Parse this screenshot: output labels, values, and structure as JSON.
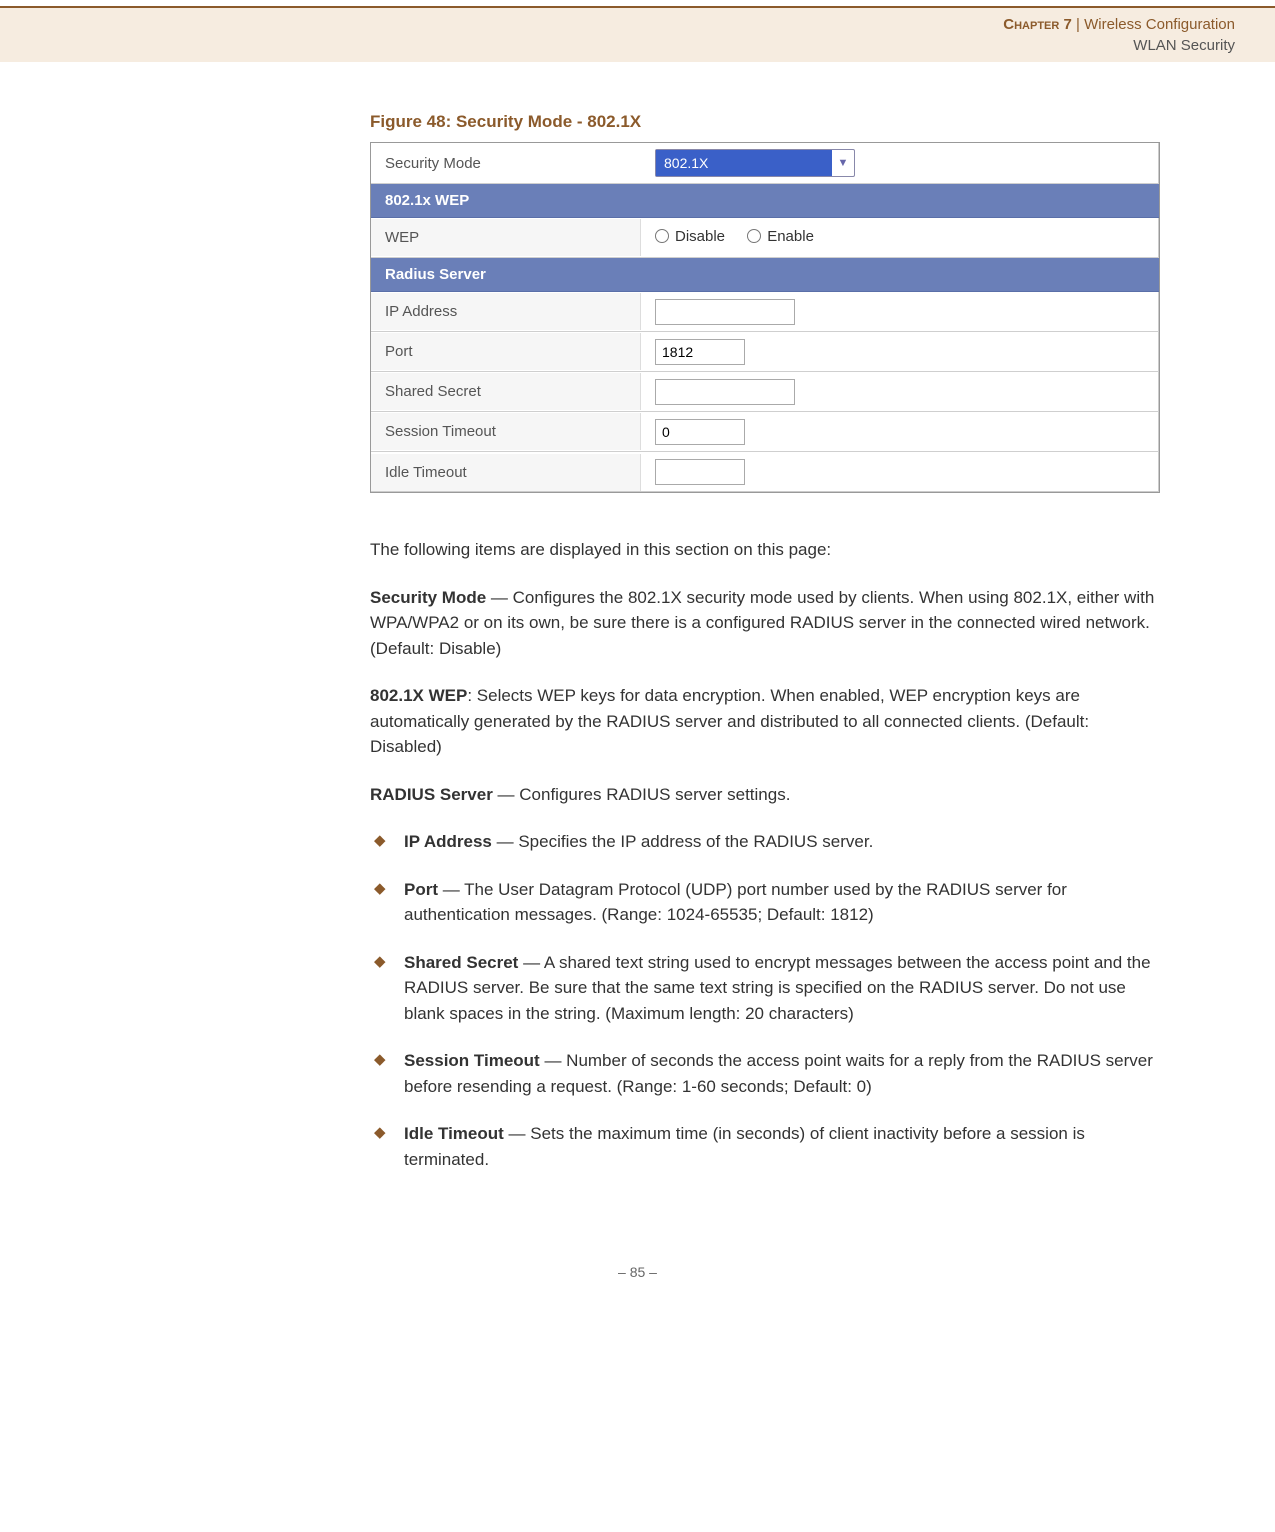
{
  "header": {
    "chapter": "Chapter 7",
    "sep": "|",
    "crumb": "Wireless Configuration",
    "sub": "WLAN Security"
  },
  "figure": {
    "caption": "Figure 48:  Security Mode - 802.1X",
    "securityMode": {
      "label": "Security Mode",
      "value": "802.1X"
    },
    "section1": "802.1x WEP",
    "wep": {
      "label": "WEP",
      "opt1": "Disable",
      "opt2": "Enable"
    },
    "section2": "Radius Server",
    "ip": {
      "label": "IP Address",
      "value": ""
    },
    "port": {
      "label": "Port",
      "value": "1812"
    },
    "secret": {
      "label": "Shared Secret",
      "value": ""
    },
    "session": {
      "label": "Session Timeout",
      "value": "0"
    },
    "idle": {
      "label": "Idle Timeout",
      "value": ""
    }
  },
  "body": {
    "intro": "The following items are displayed in this section on this page:",
    "p1b": "Security Mode",
    "p1": " — Configures the 802.1X security mode used by clients. When using 802.1X, either with WPA/WPA2 or on its own, be sure there is a configured RADIUS server in the connected wired network. (Default: Disable)",
    "p2b": "802.1X WEP",
    "p2": ": Selects WEP keys for data encryption. When enabled, WEP encryption keys are automatically generated by the RADIUS server and distributed to all connected clients. (Default: Disabled)",
    "p3b": "RADIUS Server",
    "p3": " — Configures RADIUS server settings.",
    "li1b": "IP Address",
    "li1": " — Specifies the IP address of the RADIUS server.",
    "li2b": "Port",
    "li2": " — The User Datagram Protocol (UDP) port number used by the RADIUS server for authentication messages. (Range: 1024-65535; Default: 1812)",
    "li3b": "Shared Secret",
    "li3": " — A shared text string used to encrypt messages between the access point and the RADIUS server. Be sure that the same text string is specified on the RADIUS server. Do not use blank spaces in the string. (Maximum length: 20 characters)",
    "li4b": "Session Timeout",
    "li4": " — Number of seconds the access point waits for a reply from the RADIUS server before resending a request. (Range: 1-60 seconds; Default: 0)",
    "li5b": "Idle Timeout",
    "li5": " — Sets the maximum time (in seconds) of client inactivity before a session is terminated."
  },
  "footer": "–  85  –"
}
